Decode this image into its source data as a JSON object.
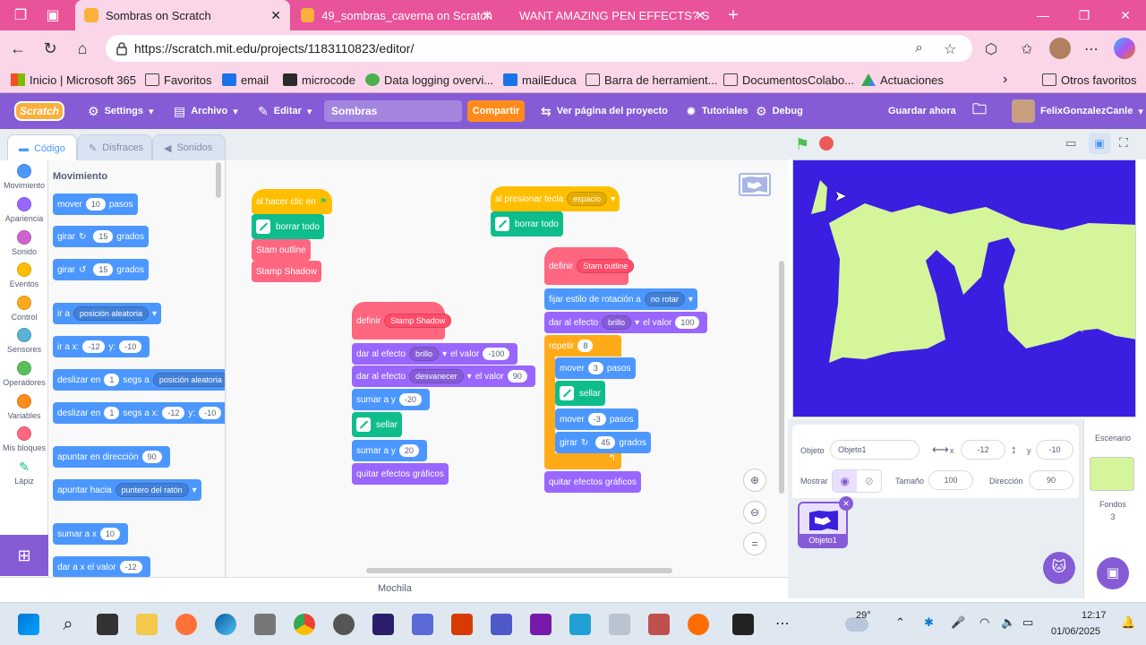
{
  "browser": {
    "tabs": [
      {
        "label": "Sombras on Scratch",
        "active": true
      },
      {
        "label": "49_sombras_caverna on Scratch",
        "active": false
      },
      {
        "label": "WANT AMAZING PEN EFFECTS? S",
        "active": false
      }
    ],
    "url": "https://scratch.mit.edu/projects/1183110823/editor/",
    "favorites": [
      "Inicio | Microsoft 365",
      "Favoritos",
      "email",
      "microcode",
      "Data logging overvi...",
      "mailEduca",
      "Barra de herramient...",
      "DocumentosColabo...",
      "Actuaciones",
      "Otros favoritos"
    ]
  },
  "scratch": {
    "logo": "Scratch",
    "menu": {
      "settings": "Settings",
      "archivo": "Archivo",
      "editar": "Editar",
      "project_title": "Sombras",
      "share": "Compartir",
      "view_project": "Ver página del proyecto",
      "tutorials": "Tutoriales",
      "debug": "Debug",
      "save_now": "Guardar ahora",
      "username": "FelixGonzalezCanle"
    },
    "editor_tabs": [
      "Código",
      "Disfraces",
      "Sonidos"
    ],
    "categories": [
      {
        "label": "Movimiento",
        "color": "#4c97ff"
      },
      {
        "label": "Apariencia",
        "color": "#9966ff"
      },
      {
        "label": "Sonido",
        "color": "#cf63cf"
      },
      {
        "label": "Eventos",
        "color": "#ffbf00"
      },
      {
        "label": "Control",
        "color": "#ffab19"
      },
      {
        "label": "Sensores",
        "color": "#5cb1d6"
      },
      {
        "label": "Operadores",
        "color": "#59c059"
      },
      {
        "label": "Variables",
        "color": "#ff8c1a"
      },
      {
        "label": "Mis bloques",
        "color": "#ff6680"
      },
      {
        "label": "Lápiz",
        "color": "#0fbd8c"
      }
    ],
    "palette": {
      "heading": "Movimiento",
      "blocks": {
        "mover": "mover",
        "mover_val": "10",
        "pasos": "pasos",
        "girar": "girar",
        "grados": "grados",
        "g_val": "15",
        "ir_a": "ir a",
        "pos_aleatoria": "posición aleatoria",
        "ir_a_x": "ir a x:",
        "x_val": "-12",
        "y_label": "y:",
        "y_val": "-10",
        "deslizar_en": "deslizar en",
        "one": "1",
        "segs_a": "segs a",
        "segs_a_x": "segs a x:",
        "apuntar_dir": "apuntar en dirección",
        "dir_val": "90",
        "apuntar_hacia": "apuntar hacia",
        "puntero": "puntero del ratón",
        "sumar_a_x": "sumar a x",
        "sumar_val": "10",
        "dar_a_x": "dar a x el valor",
        "dar_x_val": "-12"
      }
    },
    "scripts": {
      "s1": {
        "hat": "al hacer clic en",
        "borrar": "borrar todo",
        "c1": "Stam outline",
        "c2": "Stamp Shadow"
      },
      "s2": {
        "hat": "al presionar tecla",
        "key": "espacio",
        "borrar": "borrar todo"
      },
      "s3": {
        "definir": "definir",
        "name": "Stamp Shadow",
        "dar_efecto": "dar al efecto",
        "brillo": "brillo",
        "el_valor": "el valor",
        "v1": "-100",
        "desvanecer": "desvanecer",
        "v2": "90",
        "sumar_a_y": "sumar a y",
        "v3": "-20",
        "sellar": "sellar",
        "v4": "20",
        "quitar": "quitar efectos gráficos"
      },
      "s4": {
        "definir": "definir",
        "name": "Stam outline",
        "fijar": "fijar estilo de rotación a",
        "no_rotar": "no rotar",
        "dar_efecto": "dar al efecto",
        "brillo": "brillo",
        "el_valor": "el valor",
        "v1": "100",
        "repetir": "repetir",
        "rep_val": "8",
        "mover": "mover",
        "m1": "3",
        "pasos": "pasos",
        "sellar": "sellar",
        "m2": "-3",
        "girar": "girar",
        "gr": "45",
        "grados": "grados",
        "quitar": "quitar efectos gráficos"
      }
    },
    "sprite_info": {
      "objeto_label": "Objeto",
      "objeto_val": "Objeto1",
      "x_label": "x",
      "x_val": "-12",
      "y_label": "y",
      "y_val": "-10",
      "mostrar_label": "Mostrar",
      "tamano_label": "Tamaño",
      "tamano_val": "100",
      "direccion_label": "Dirección",
      "direccion_val": "90",
      "sprite_thumb_label": "Objeto1"
    },
    "backdrop": {
      "title": "Escenario",
      "fondos_label": "Fondos",
      "fondos_count": "3"
    },
    "mochila": "Mochila",
    "stage_colors": {
      "bg": "#3a1fe0",
      "fg": "#d4f59a"
    }
  },
  "taskbar": {
    "weather": "29°",
    "time": "12:17",
    "date": "01/06/2025"
  }
}
